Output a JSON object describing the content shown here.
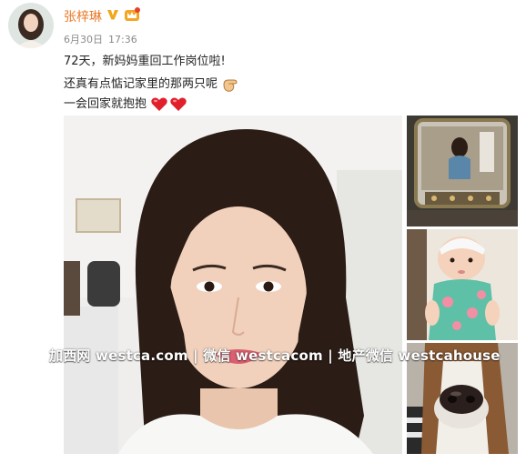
{
  "post": {
    "username": "张梓琳",
    "verified_icon": "verified-v-icon",
    "vip_icon": "vip-crown-icon",
    "date": "6月30日",
    "time": "17:36",
    "line1": "72天，新妈妈重回工作岗位啦!",
    "line2": "还真有点惦记家里的那两只呢",
    "line3": "一会回家就抱抱",
    "emoji_line2": "pointing-paw-icon",
    "emoji_line3": "two-red-hearts-icon"
  },
  "watermark": "加西网 westca.com | 微信 westcacom | 地产微信 westcahouse",
  "colors": {
    "username": "#ea7a2a",
    "timestamp": "#8a8a8a",
    "heart": "#e0202b"
  }
}
